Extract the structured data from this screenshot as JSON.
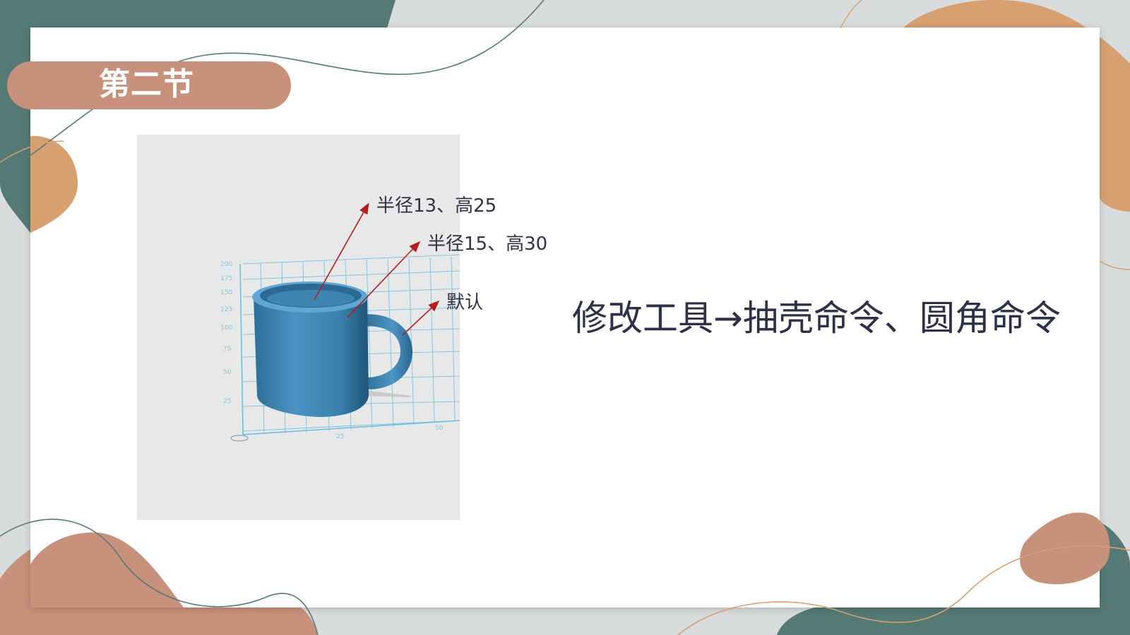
{
  "slide": {
    "title": "第二节",
    "main_text": "修改工具→抽壳命令、圆角命令"
  },
  "callouts": [
    {
      "label": "半径13、高25"
    },
    {
      "label": "半径15、高30"
    },
    {
      "label": "默认"
    }
  ],
  "grid_ticks": {
    "y": [
      "200",
      "175",
      "150",
      "125",
      "100",
      "75",
      "50",
      "25"
    ],
    "x": [
      "25",
      "50"
    ]
  },
  "icons": {
    "cup": "mug-3d-model-icon",
    "arrow": "red-arrow"
  },
  "colors": {
    "teal": "#557a76",
    "tan": "#d6a070",
    "rose": "#c7917b",
    "cup_blue": "#3f86b4",
    "grid_blue": "#54b8e0",
    "arrow_red": "#b41e1e",
    "text_dark": "#2d3046"
  }
}
